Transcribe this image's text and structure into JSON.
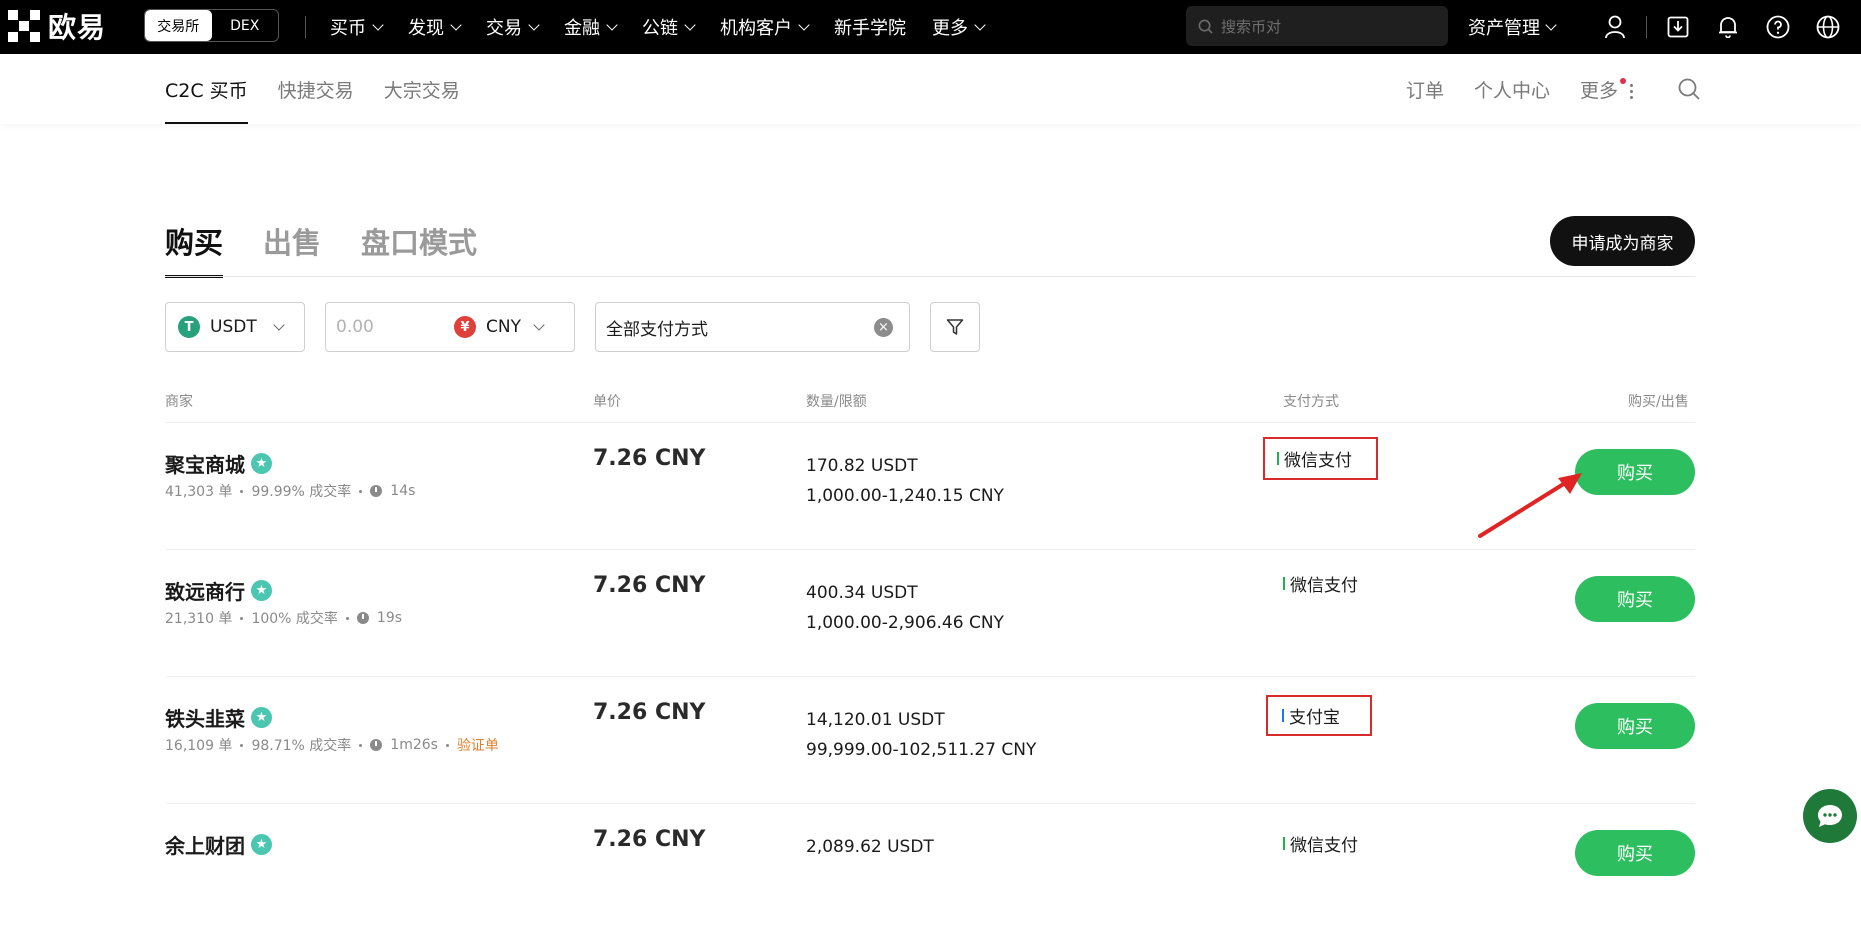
{
  "topbar": {
    "logo_text": "欧易",
    "mode_switch": [
      "交易所",
      "DEX"
    ],
    "nav": [
      "买币",
      "发现",
      "交易",
      "金融",
      "公链",
      "机构客户",
      "新手学院",
      "更多"
    ],
    "nav_has_chevron": [
      true,
      true,
      true,
      true,
      true,
      true,
      false,
      true
    ],
    "search_placeholder": "搜索币对",
    "asset_label": "资产管理"
  },
  "subnav": {
    "tabs": [
      "C2C 买币",
      "快捷交易",
      "大宗交易"
    ],
    "links": [
      "订单",
      "个人中心",
      "更多"
    ]
  },
  "main": {
    "tabs": [
      "购买",
      "出售",
      "盘口模式"
    ],
    "merchant_button": "申请成为商家",
    "filters": {
      "coin": "USDT",
      "amount_placeholder": "0.00",
      "fiat": "CNY",
      "payment": "全部支付方式"
    },
    "headers": {
      "merchant": "商家",
      "price": "单价",
      "quantity": "数量/限额",
      "payment": "支付方式",
      "action": "购买/出售"
    },
    "rows": [
      {
        "name": "聚宝商城",
        "orders": "41,303 单",
        "rate": "99.99% 成交率",
        "time": "14s",
        "tag": "",
        "price": "7.26 CNY",
        "qty": "170.82 USDT",
        "limit": "1,000.00-1,240.15 CNY",
        "payment": "微信支付",
        "button": "购买"
      },
      {
        "name": "致远商行",
        "orders": "21,310 单",
        "rate": "100% 成交率",
        "time": "19s",
        "tag": "",
        "price": "7.26 CNY",
        "qty": "400.34 USDT",
        "limit": "1,000.00-2,906.46 CNY",
        "payment": "微信支付",
        "button": "购买"
      },
      {
        "name": "铁头韭菜",
        "orders": "16,109 单",
        "rate": "98.71% 成交率",
        "time": "1m26s",
        "tag": "验证单",
        "price": "7.26 CNY",
        "qty": "14,120.01 USDT",
        "limit": "99,999.00-102,511.27 CNY",
        "payment": "支付宝",
        "button": "购买"
      },
      {
        "name": "余上财团",
        "orders": "",
        "rate": "",
        "time": "",
        "tag": "",
        "price": "7.26 CNY",
        "qty": "2,089.62 USDT",
        "limit": "",
        "payment": "微信支付",
        "button": "购买"
      }
    ]
  },
  "colors": {
    "buy_green": "#2dbe5f",
    "highlight_red": "#d92b2b",
    "usdt_green": "#26a17b",
    "cny_red": "#e0403a",
    "chat_green": "#1f7a3a"
  }
}
